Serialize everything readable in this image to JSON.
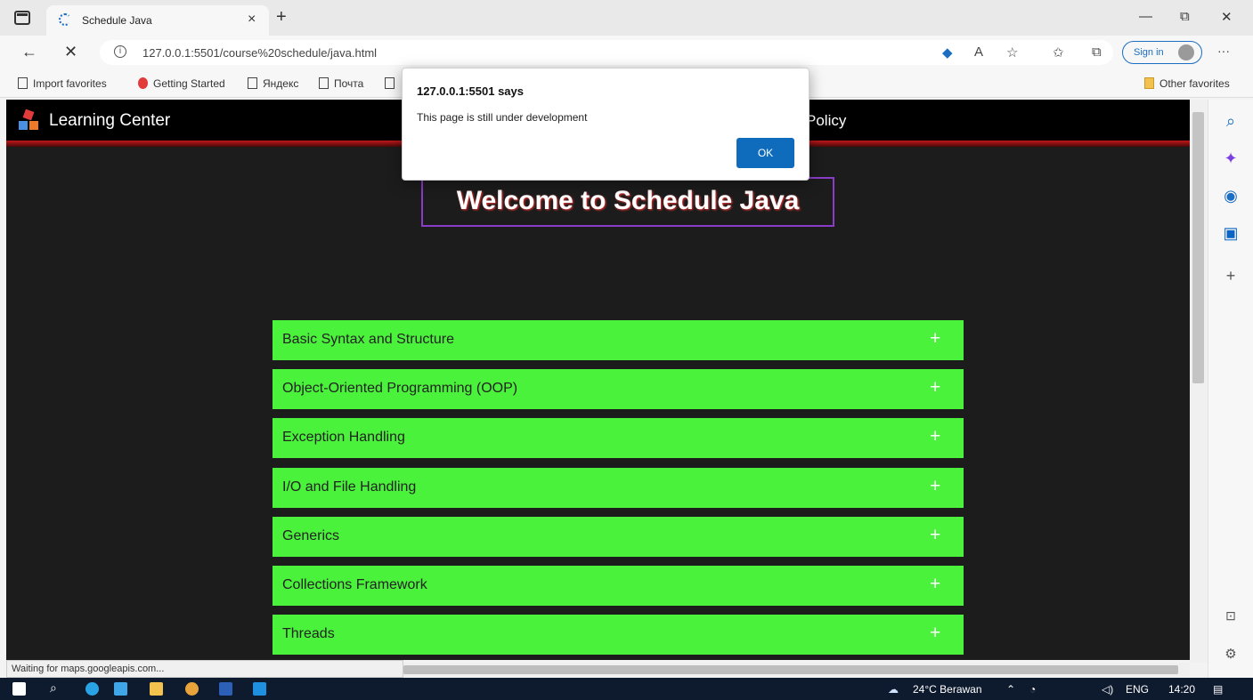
{
  "browser": {
    "tab_title": "Schedule Java",
    "tab_close": "×",
    "new_tab": "+",
    "window_controls": {
      "minimize": "—",
      "restore": "⧉",
      "close": "✕"
    },
    "url": "127.0.0.1:5501/course%20schedule/java.html",
    "sign_in": "Sign in",
    "more": "···",
    "favorites": [
      "Import favorites",
      "Getting Started",
      "Яндекс",
      "Почта"
    ],
    "other_favorites": "Other favorites",
    "status_text": "Waiting for maps.googleapis.com..."
  },
  "page": {
    "brand": "Learning Center",
    "nav_visible_item": "Policy",
    "hero_title": "Welcome to Schedule Java",
    "accordion": [
      {
        "label": "Basic Syntax and Structure",
        "icon": "+"
      },
      {
        "label": "Object-Oriented Programming (OOP)",
        "icon": "+"
      },
      {
        "label": "Exception Handling",
        "icon": "+"
      },
      {
        "label": "I/O and File Handling",
        "icon": "+"
      },
      {
        "label": "Generics",
        "icon": "+"
      },
      {
        "label": "Collections Framework",
        "icon": "+"
      },
      {
        "label": "Threads",
        "icon": "+"
      }
    ],
    "accent_color": "#4af23b"
  },
  "dialog": {
    "title": "127.0.0.1:5501 says",
    "message": "This page is still under development",
    "ok": "OK"
  },
  "taskbar": {
    "weather": "24°C  Berawan",
    "language": "ENG",
    "time": "14:20"
  }
}
